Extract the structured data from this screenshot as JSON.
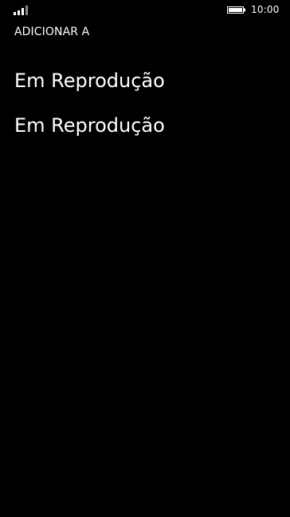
{
  "status_bar": {
    "signal_icon": "signal-strength-icon",
    "battery_icon": "battery-icon",
    "time": "10:00"
  },
  "header": {
    "title": "ADICIONAR A"
  },
  "list": {
    "items": [
      {
        "label": "Em Reprodução"
      },
      {
        "label": "Em Reprodução"
      }
    ]
  },
  "colors": {
    "background": "#000000",
    "foreground": "#ffffff"
  }
}
